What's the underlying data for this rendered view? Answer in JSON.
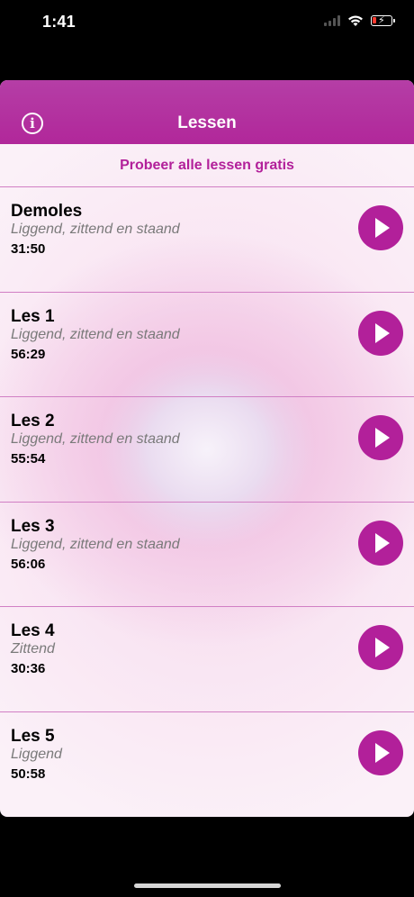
{
  "status_bar": {
    "time": "1:41"
  },
  "nav": {
    "title": "Lessen"
  },
  "promo": {
    "label": "Probeer alle lessen gratis"
  },
  "lessons": [
    {
      "title": "Demoles",
      "subtitle": "Liggend, zittend en staand",
      "duration": "31:50"
    },
    {
      "title": "Les 1",
      "subtitle": "Liggend, zittend en staand",
      "duration": "56:29"
    },
    {
      "title": "Les 2",
      "subtitle": "Liggend, zittend en staand",
      "duration": "55:54"
    },
    {
      "title": "Les 3",
      "subtitle": "Liggend, zittend en staand",
      "duration": "56:06"
    },
    {
      "title": "Les 4",
      "subtitle": "Zittend",
      "duration": "30:36"
    },
    {
      "title": "Les 5",
      "subtitle": "Liggend",
      "duration": "50:58"
    }
  ],
  "colors": {
    "accent": "#b2209a",
    "navbar": "#b53ea6",
    "divider": "#d17fc4"
  },
  "icons": {
    "info": "info-icon",
    "play": "play-icon",
    "wifi": "wifi-icon",
    "battery": "battery-icon"
  }
}
